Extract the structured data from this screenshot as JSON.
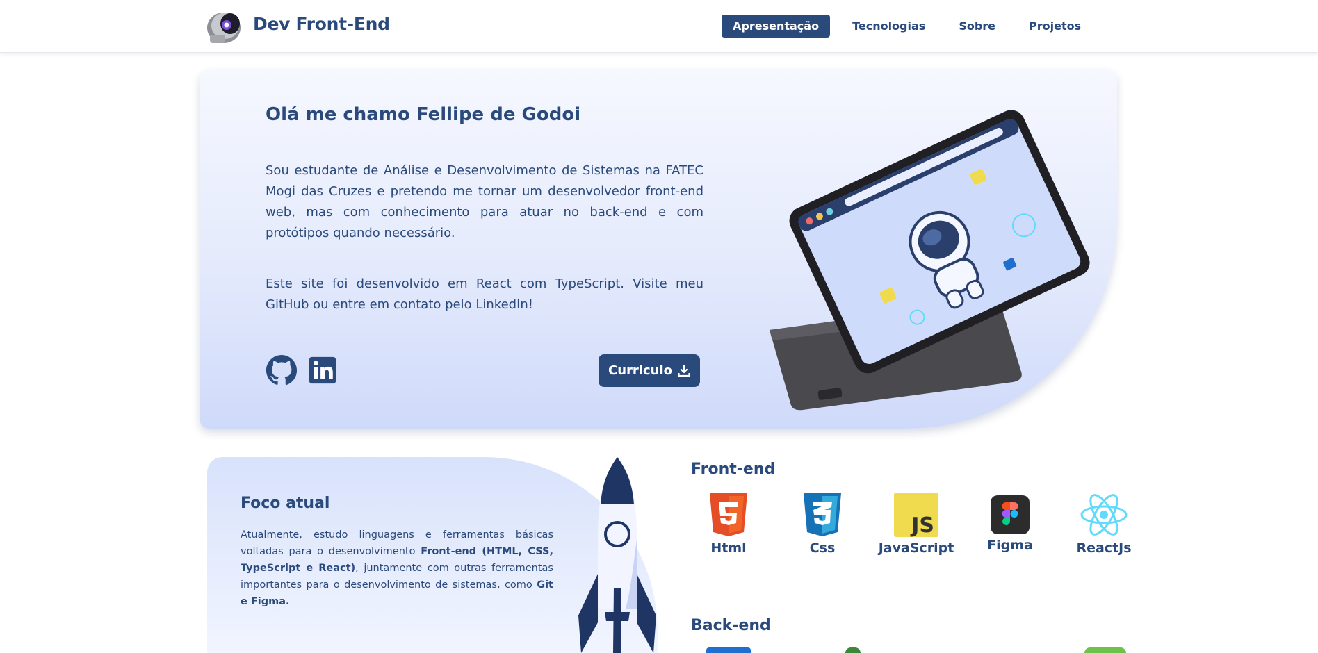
{
  "header": {
    "brand": "Dev Front-End",
    "nav": [
      "Apresentação",
      "Tecnologias",
      "Sobre",
      "Projetos"
    ],
    "active_index": 0
  },
  "hero": {
    "title": "Olá me chamo Fellipe de Godoi",
    "paragraph1": "Sou estudante de Análise e Desenvolvimento de Sistemas na FATEC Mogi das Cruzes e pretendo me tornar um desenvolvedor front-end web, mas com conhecimento para atuar no back-end e com protótipos quando necessário.",
    "paragraph2": "Este site foi desenvolvido em React com TypeScript. Visite meu GitHub ou entre em contato pelo LinkedIn!",
    "cv_button": "Curriculo",
    "socials": [
      "github-icon",
      "linkedin-icon"
    ]
  },
  "focus": {
    "title": "Foco atual",
    "text_parts": [
      "Atualmente, estudo linguagens e ferramentas básicas voltadas para o desenvolvimento ",
      "Front-end (HTML, CSS, TypeScript e React)",
      ", juntamente com outras ferramentas importantes para o desenvolvimento de sistemas, como ",
      "Git e Figma."
    ]
  },
  "tech": {
    "frontend_title": "Front-end",
    "frontend": [
      "Html",
      "Css",
      "JavaScript",
      "Figma",
      "ReactJs"
    ],
    "backend_title": "Back-end"
  },
  "colors": {
    "primary": "#2b4a7c",
    "html": "#e44d26",
    "css": "#1572b6",
    "js": "#f0db4f",
    "react": "#61dafb"
  }
}
